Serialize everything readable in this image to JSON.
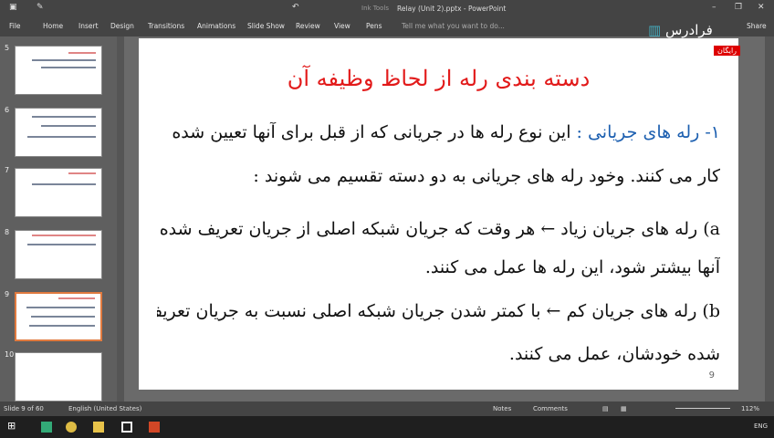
{
  "titlebar": {
    "context": "Ink Tools",
    "title": "Relay (Unit 2).pptx - PowerPoint"
  },
  "tabs": [
    "File",
    "Home",
    "Insert",
    "Design",
    "Transitions",
    "Animations",
    "Slide Show",
    "Review",
    "View",
    "Pens"
  ],
  "tell_me": "Tell me what you want to do...",
  "share": "Share",
  "logo": {
    "text": "فرادرس",
    "badge": "رایگان"
  },
  "thumbnails": [
    "5",
    "6",
    "7",
    "8",
    "9",
    "10"
  ],
  "slide": {
    "title": "دسته بندی رله از لحاظ وظیفه آن",
    "heading": "۱- رله های جریانی :",
    "lines": [
      "این نوع رله ها در جریانی که از قبل برای آنها تعیین شده",
      "کار می کنند. وخود رله های جریانی به دو دسته تقسیم می شوند :",
      "a) رله های جریان زیاد ← هر وقت که جریان شبکه اصلی از جریان تعریف شده",
      "آنها بیشتر شود، این رله ها عمل می کنند.",
      "b) رله های جریان کم ← با کمتر شدن جریان شبکه اصلی نسبت به جریان تعریف",
      "شده خودشان، عمل می کنند."
    ],
    "number": "9"
  },
  "status": {
    "slide": "Slide 9 of 60",
    "language": "English (United States)",
    "notes": "Notes",
    "comments": "Comments",
    "zoom": "112%"
  },
  "taskbar": {
    "lang": "ENG"
  }
}
